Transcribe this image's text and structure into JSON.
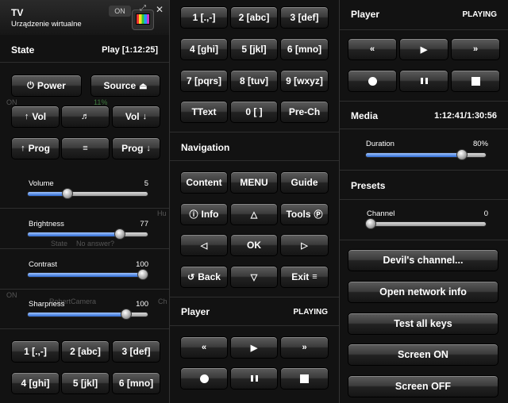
{
  "left": {
    "device_title": "TV",
    "device_subtitle": "Urządzenie wirtualne",
    "on_toggle": "ON",
    "state_label": "State",
    "state_value": "Play [1:12:25]",
    "buttons": {
      "power": "Power",
      "source": "Source",
      "vol_up": "Vol",
      "vol_down": "Vol",
      "prog_up": "Prog",
      "prog_down": "Prog"
    },
    "sliders": [
      {
        "label": "Volume",
        "value": "5",
        "level": 0.33
      },
      {
        "label": "Brightness",
        "value": "77",
        "level": 0.77
      },
      {
        "label": "Contrast",
        "value": "100",
        "level": 1.0
      },
      {
        "label": "Sharpness",
        "value": "100",
        "level": 0.82
      }
    ],
    "keypad": [
      "1 [.,-]",
      "2 [abc]",
      "3 [def]",
      "4 [ghi]",
      "5 [jkl]",
      "6 [mno]"
    ],
    "ghost": {
      "on1": "ON",
      "on2": "ON",
      "state": "State",
      "no_answer": "No answer?",
      "camera": "RobertCamera",
      "hu": "Hu",
      "ch": "Ch",
      "percent": "11%"
    }
  },
  "mid": {
    "keypad": [
      "1 [.,-]",
      "2 [abc]",
      "3 [def]",
      "4 [ghi]",
      "5 [jkl]",
      "6 [mno]",
      "7 [pqrs]",
      "8 [tuv]",
      "9 [wxyz]",
      "TText",
      "0 [ ]",
      "Pre-Ch"
    ],
    "navigation_label": "Navigation",
    "nav": {
      "content": "Content",
      "menu": "MENU",
      "guide": "Guide",
      "info": "Info",
      "tools": "Tools",
      "ok": "OK",
      "back": "Back",
      "exit": "Exit"
    },
    "player_label": "Player",
    "player_status": "PLAYING"
  },
  "right": {
    "player_label": "Player",
    "player_status": "PLAYING",
    "media_label": "Media",
    "media_time": "1:12:41/1:30:56",
    "duration_label": "Duration",
    "duration_value": "80%",
    "duration_level": 0.8,
    "presets_label": "Presets",
    "channel_label": "Channel",
    "channel_value": "0",
    "channel_level": 0.0,
    "buttons": [
      "Devil's channel...",
      "Open network info",
      "Test all keys",
      "Screen ON",
      "Screen OFF"
    ]
  },
  "colors": {
    "accent_fill": "#2e6ad2",
    "panel_bg": "#121212",
    "button_top": "#5c5c5c",
    "button_bottom": "#151515"
  },
  "icons": {
    "power": "power-icon",
    "eject": "eject-icon",
    "music": "music-note-icon",
    "list": "list-icon",
    "info": "info-icon",
    "tools": "tools-p-icon",
    "back": "back-arrow-icon",
    "exit": "exit-icon"
  }
}
